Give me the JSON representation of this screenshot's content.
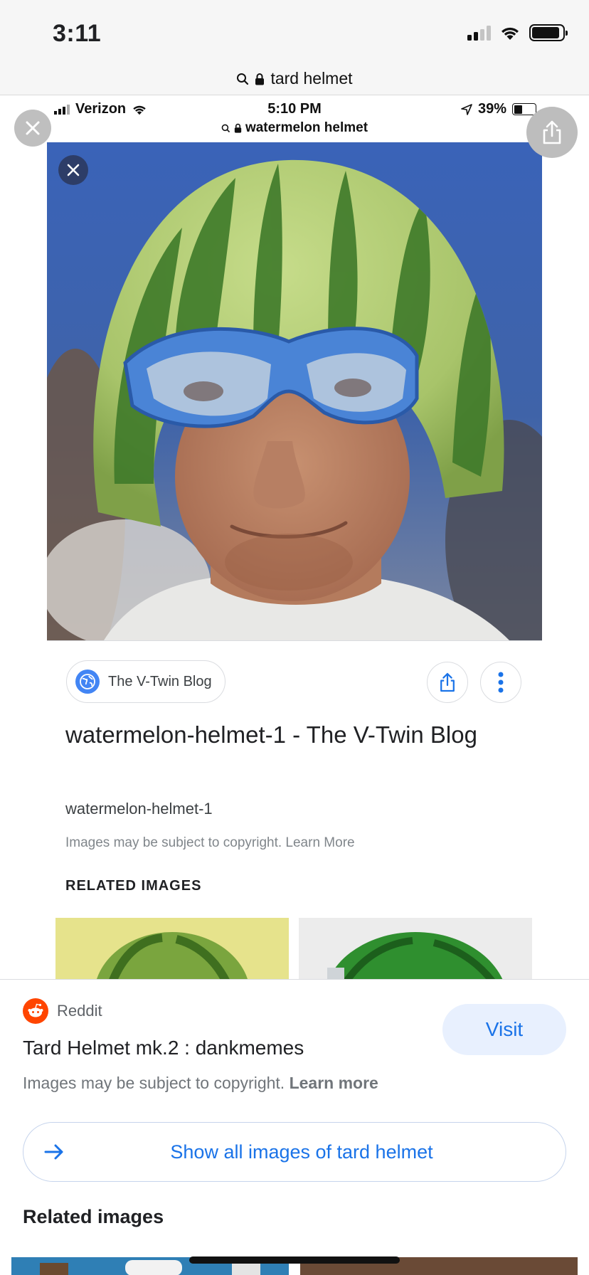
{
  "status_bar": {
    "time": "3:11",
    "signal_icon": "cellular-signal-icon",
    "wifi_icon": "wifi-icon",
    "battery_icon": "battery-icon",
    "battery_level": 0.9
  },
  "url_bar": {
    "search_icon": "search-icon",
    "lock_icon": "lock-icon",
    "query": "tard helmet"
  },
  "embedded_screenshot": {
    "status": {
      "carrier": "Verizon",
      "time": "5:10 PM",
      "battery": "39%",
      "battery_level": 0.39
    },
    "url": "watermelon helmet",
    "photo_close_icon": "close-icon",
    "source_name": "The V-Twin Blog",
    "source_icon": "globe-icon",
    "share_icon": "share-icon",
    "more_icon": "more-vert-icon",
    "title": "watermelon-helmet-1 - The V-Twin Blog",
    "subtitle": "watermelon-helmet-1",
    "copyright": "Images may be subject to copyright. Learn More",
    "related_heading": "RELATED IMAGES"
  },
  "overlay": {
    "close_icon": "close-icon",
    "share_icon": "share-icon"
  },
  "card": {
    "source_icon": "reddit-icon",
    "source_name": "Reddit",
    "title": "Tard Helmet mk.2 : dankmemes",
    "copyright_text": "Images may be subject to copyright.",
    "learn_more": "Learn more",
    "visit_label": "Visit",
    "show_all_icon": "arrow-right-icon",
    "show_all_label": "Show all images of tard helmet",
    "related_heading": "Related images"
  },
  "colors": {
    "link_blue": "#1a73e8",
    "visit_bg": "#e8f0fe",
    "reddit_orange": "#ff4500"
  }
}
